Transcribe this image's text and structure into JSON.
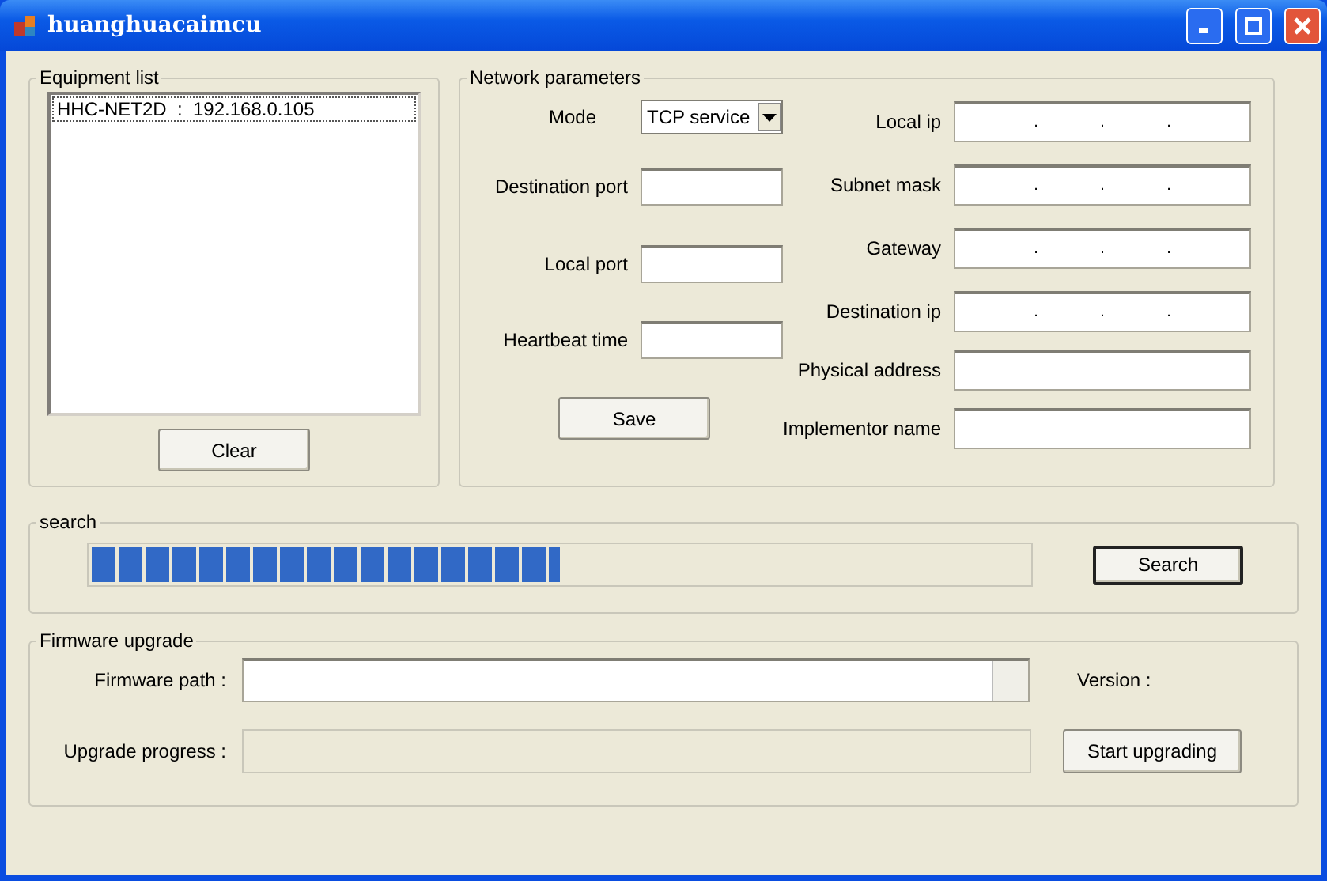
{
  "window": {
    "title": "huanghuacaimcu"
  },
  "equipment_list": {
    "title": "Equipment list",
    "items": [
      {
        "label": "HHC-NET2D  :  192.168.0.105",
        "selected": true
      }
    ],
    "clear_button": "Clear"
  },
  "network_parameters": {
    "title": "Network parameters",
    "left_fields": [
      {
        "kind": "select",
        "label": "Mode",
        "value": "TCP service"
      },
      {
        "kind": "text",
        "label": "Destination port"
      },
      {
        "kind": "text",
        "label": "Local port"
      },
      {
        "kind": "text",
        "label": "Heartbeat time"
      }
    ],
    "save_button": "Save",
    "right_fields": [
      {
        "kind": "ip",
        "label": "Local ip",
        "separators": [
          ".",
          ".",
          "."
        ]
      },
      {
        "kind": "ip",
        "label": "Subnet mask",
        "separators": [
          ".",
          ".",
          "."
        ]
      },
      {
        "kind": "ip",
        "label": "Gateway",
        "separators": [
          ".",
          ".",
          "."
        ]
      },
      {
        "kind": "ip",
        "label": "Destination ip",
        "separators": [
          ".",
          ".",
          "."
        ]
      },
      {
        "kind": "text",
        "label": "Physical address"
      },
      {
        "kind": "text",
        "label": "Implementor name"
      }
    ]
  },
  "search": {
    "title": "search",
    "level": 0.5,
    "button": "Search"
  },
  "firmware_upgrade": {
    "title": "Firmware upgrade",
    "path_label": "Firmware path :",
    "version_label": "Version :",
    "progress_label": "Upgrade progress :",
    "level": 0,
    "button": "Start upgrading"
  }
}
